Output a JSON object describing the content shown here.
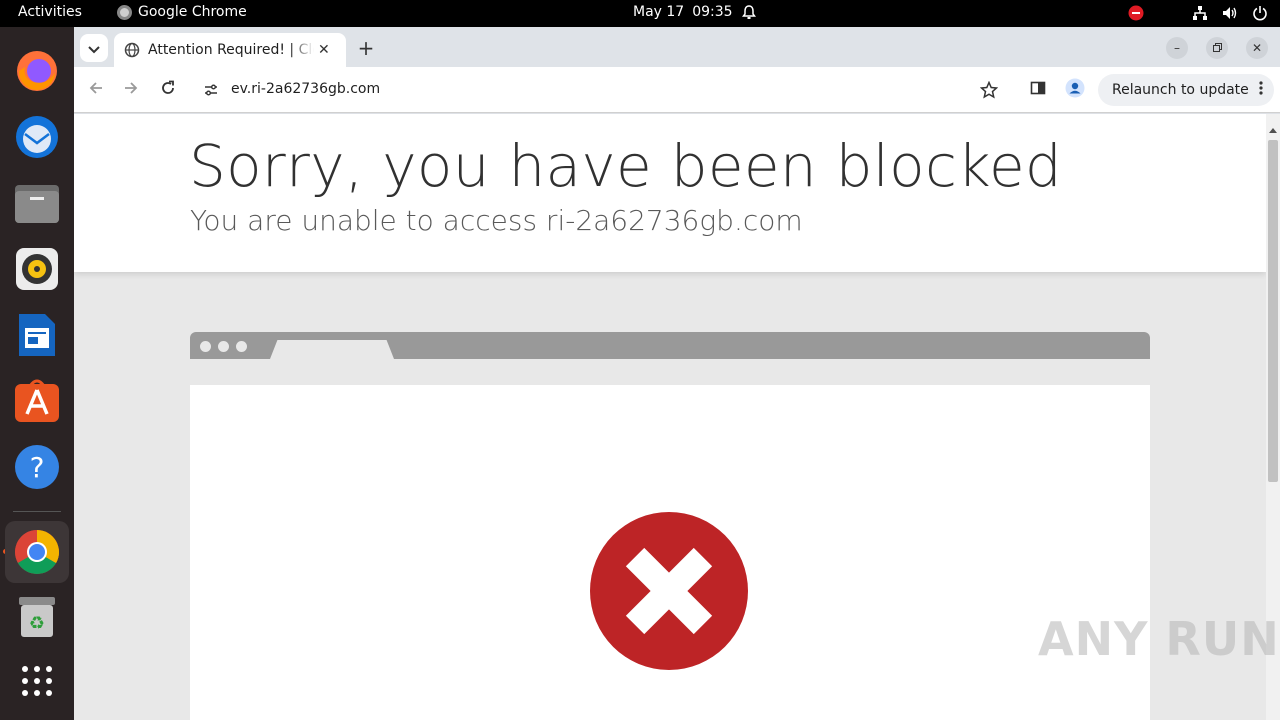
{
  "topbar": {
    "activities": "Activities",
    "app_name": "Google Chrome",
    "date": "May 17",
    "time": "09:35"
  },
  "dock": {
    "items": [
      "firefox-icon",
      "thunderbird-icon",
      "files-icon",
      "rhythmbox-icon",
      "libreoffice-writer-icon",
      "ubuntu-software-icon",
      "help-icon",
      "chrome-icon",
      "trash-icon",
      "app-grid-icon"
    ],
    "active": "chrome-icon"
  },
  "browser": {
    "tab_title": "Attention Required! | Cloudflare",
    "url": "ev.ri-2a62736gb.com",
    "relaunch_label": "Relaunch to update"
  },
  "page": {
    "heading": "Sorry, you have been blocked",
    "subheading": "You are unable to access ri-2a62736gb.com"
  },
  "watermark": "ANY RUN",
  "colors": {
    "error_red": "#bd2426",
    "ubuntu_orange": "#e95420"
  }
}
